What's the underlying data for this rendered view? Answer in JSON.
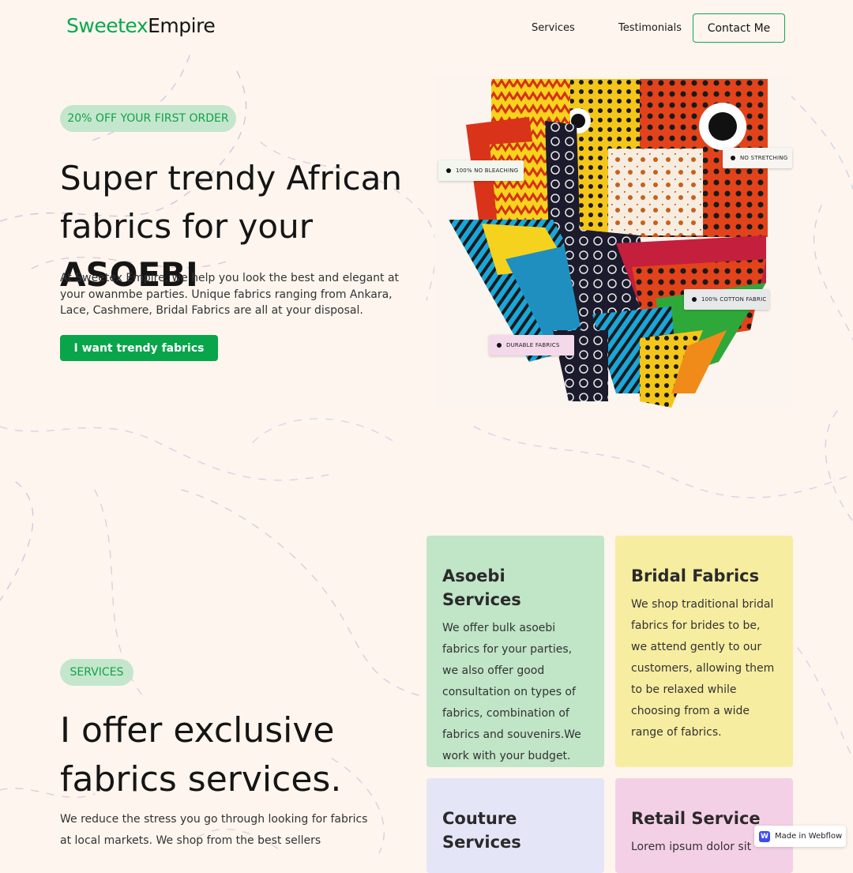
{
  "brand": {
    "logo_part1": "Sweetex",
    "logo_part2": "Empire",
    "accent_color": "#0aa84f"
  },
  "nav": {
    "items": [
      {
        "label": "Services"
      },
      {
        "label": "Testimonials"
      }
    ],
    "contact_label": "Contact Me"
  },
  "hero": {
    "badge": "20% OFF YOUR FIRST ORDER",
    "title": "Super trendy African fabrics for your",
    "title_emphasis": "ASOEBI",
    "description": "At Sweetex Empire, we help you look the best and elegant at your owanmbe parties. Unique fabrics ranging from Ankara, Lace, Cashmere, Bridal Fabrics are all at your disposal.",
    "cta_label": "I want trendy fabrics",
    "image_tags": [
      {
        "label": "100% NO BLEACHING"
      },
      {
        "label": "NO STRETCHING"
      },
      {
        "label": "100% COTTON  FABRIC"
      },
      {
        "label": "DURABLE FABRICS"
      }
    ]
  },
  "services": {
    "badge": "SERVICES",
    "title": "I offer exclusive fabrics services.",
    "description": "We reduce the stress you go through looking for fabrics at local markets. We shop from the best sellers",
    "cards": [
      {
        "title": "Asoebi Services",
        "body": "We offer bulk asoebi fabrics for your parties, we also offer good consultation on types of fabrics, combination of fabrics and souvenirs.We work with your budget.",
        "color": "#c0e5c7"
      },
      {
        "title": "Bridal Fabrics",
        "body": "We shop traditional bridal fabrics for brides to be, we attend gently to our customers, allowing them to be relaxed while choosing from a wide range of fabrics.",
        "color": "#f7eda0"
      },
      {
        "title": "Couture Services",
        "body": "",
        "color": "#e4e6f7"
      },
      {
        "title": "Retail Service",
        "body": "Lorem ipsum dolor sit",
        "color": "#f4d0e6"
      }
    ]
  },
  "badge": {
    "label": "Made in Webflow",
    "icon": "webflow-icon"
  }
}
